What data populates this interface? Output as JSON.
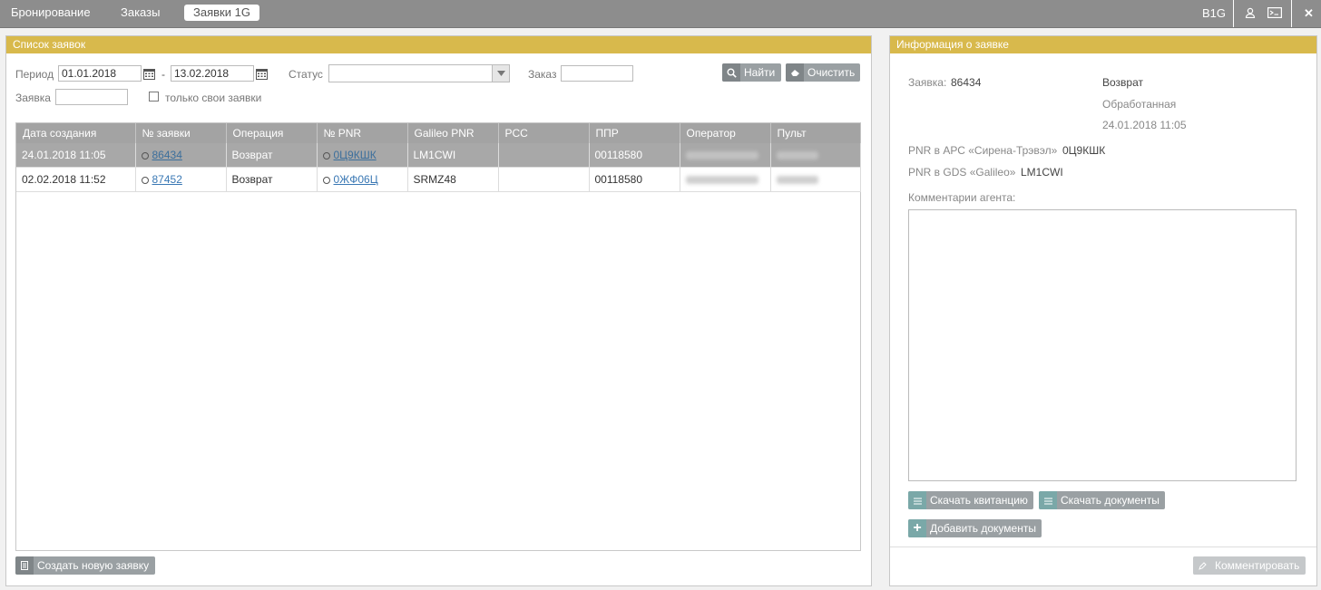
{
  "topbar": {
    "tabs": [
      "Бронирование",
      "Заказы",
      "Заявки 1G"
    ],
    "user": "B1G",
    "icons": [
      "user-icon",
      "mail-icon",
      "close-icon"
    ]
  },
  "list_panel": {
    "title": "Список заявок",
    "period_label": "Период",
    "date_from": "01.01.2018",
    "date_sep": "-",
    "date_to": "13.02.2018",
    "status_label": "Статус",
    "status_value": "",
    "order_label": "Заказ",
    "order_value": "",
    "request_label": "Заявка",
    "request_value": "",
    "own_only_label": "только свои заявки",
    "find_button": "Найти",
    "clear_button": "Очистить",
    "create_button": "Создать новую заявку",
    "columns": [
      "Дата создания",
      "№ заявки",
      "Операция",
      "№ PNR",
      "Galileo PNR",
      "PCC",
      "ППР",
      "Оператор",
      "Пульт"
    ],
    "rows": [
      {
        "date": "24.01.2018 11:05",
        "num": "86434",
        "op": "Возврат",
        "pnr": "0Ц9КШК",
        "galileo": "LM1CWI",
        "pcc": "",
        "ppr": "00118580",
        "operator": "",
        "desk": ""
      },
      {
        "date": "02.02.2018 11:52",
        "num": "87452",
        "op": "Возврат",
        "pnr": "0ЖФ06Ц",
        "galileo": "SRMZ48",
        "pcc": "",
        "ppr": "00118580",
        "operator": "",
        "desk": ""
      }
    ]
  },
  "info_panel": {
    "title": "Информация о заявке",
    "request_label": "Заявка:",
    "request_num": "86434",
    "operation": "Возврат",
    "status": "Обработанная",
    "datetime": "24.01.2018 11:05",
    "apc_label": "PNR в АРС «Сирена-Трэвэл»",
    "apc_value": "0Ц9КШК",
    "gds_label": "PNR в GDS «Galileo»",
    "gds_value": "LM1CWI",
    "comments_label": "Комментарии агента:",
    "comments_value": "",
    "download_receipt": "Скачать квитанцию",
    "download_docs": "Скачать документы",
    "add_docs": "Добавить документы",
    "comment_button": "Комментировать"
  }
}
